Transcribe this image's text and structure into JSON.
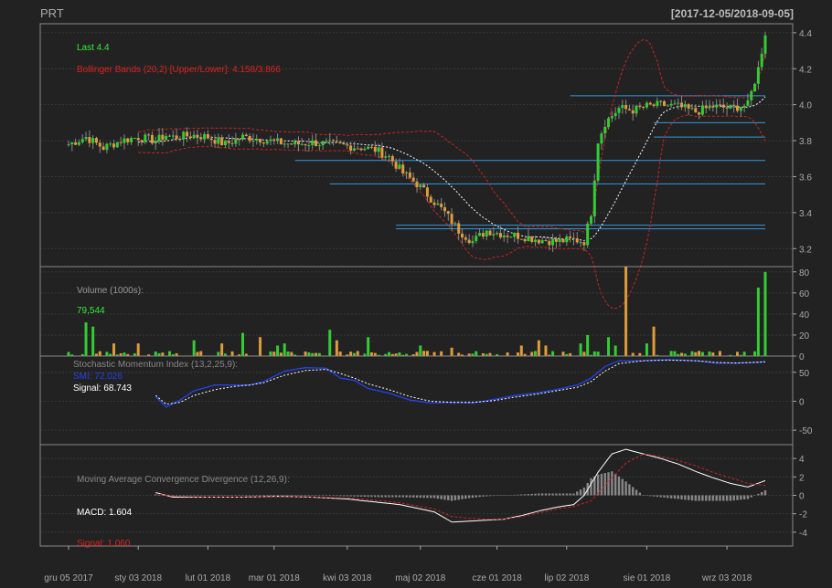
{
  "header": {
    "symbol": "PRT",
    "date_range": "[2017-12-05/2018-09-05]"
  },
  "colors": {
    "background": "#222222",
    "panel_border": "#888888",
    "grid": "#3a3a3a",
    "up": "#33cc33",
    "down": "#e09a3a",
    "bbands": "#cc2222",
    "sma": "#ffffff",
    "support_line": "#3399dd",
    "smi": "#2244ee",
    "signal": "#ffffff",
    "macd": "#ffffff",
    "macd_signal": "#cc2222",
    "histogram": "#888888",
    "axis_text": "#aaaaaa"
  },
  "chart_data": [
    {
      "type": "candlestick",
      "panel": "price",
      "title": "PRT",
      "date_range": "[2017-12-05/2018-09-05]",
      "last_label": "Last 4.4",
      "bbands_label": "Bollinger Bands (20,2) [Upper/Lower]: 4.158/3.866",
      "ylim": [
        3.1,
        4.45
      ],
      "y_ticks": [
        "3.2",
        "3.4",
        "3.6",
        "3.8",
        "4.0",
        "4.2",
        "4.4"
      ],
      "close_keypoints": [
        [
          0,
          3.78
        ],
        [
          5,
          3.82
        ],
        [
          10,
          3.76
        ],
        [
          15,
          3.8
        ],
        [
          20,
          3.82
        ],
        [
          25,
          3.8
        ],
        [
          28,
          3.83
        ],
        [
          30,
          3.82
        ],
        [
          36,
          3.83
        ],
        [
          40,
          3.82
        ],
        [
          45,
          3.78
        ],
        [
          50,
          3.82
        ],
        [
          55,
          3.81
        ],
        [
          60,
          3.79
        ],
        [
          65,
          3.78
        ],
        [
          70,
          3.79
        ],
        [
          75,
          3.78
        ],
        [
          80,
          3.77
        ],
        [
          85,
          3.76
        ],
        [
          88,
          3.75
        ],
        [
          92,
          3.71
        ],
        [
          96,
          3.62
        ],
        [
          100,
          3.56
        ],
        [
          104,
          3.48
        ],
        [
          108,
          3.4
        ],
        [
          112,
          3.3
        ],
        [
          116,
          3.24
        ],
        [
          120,
          3.3
        ],
        [
          125,
          3.28
        ],
        [
          130,
          3.27
        ],
        [
          135,
          3.25
        ],
        [
          140,
          3.24
        ],
        [
          145,
          3.25
        ],
        [
          148,
          3.24
        ],
        [
          150,
          3.4
        ],
        [
          152,
          3.8
        ],
        [
          154,
          3.9
        ],
        [
          158,
          3.98
        ],
        [
          162,
          3.97
        ],
        [
          166,
          3.99
        ],
        [
          170,
          4.0
        ],
        [
          175,
          3.99
        ],
        [
          180,
          3.96
        ],
        [
          185,
          3.99
        ],
        [
          190,
          3.98
        ],
        [
          195,
          4.0
        ],
        [
          198,
          4.2
        ],
        [
          200,
          4.4
        ]
      ],
      "support_lines": [
        {
          "y": 4.05,
          "from": 144
        },
        {
          "y": 3.9,
          "from": 168
        },
        {
          "y": 3.82,
          "from": 168
        },
        {
          "y": 3.69,
          "from": 65
        },
        {
          "y": 3.56,
          "from": 75
        },
        {
          "y": 3.33,
          "from": 94
        },
        {
          "y": 3.31,
          "from": 94
        },
        {
          "y": 3.1,
          "from": 111
        }
      ]
    },
    {
      "type": "bar",
      "panel": "volume",
      "label": "Volume (1000s):",
      "value_label": "79,544",
      "ylim": [
        0,
        85
      ],
      "y_ticks": [
        "0",
        "20",
        "40",
        "60",
        "80"
      ],
      "spikes": [
        [
          5,
          32
        ],
        [
          7,
          28
        ],
        [
          13,
          12
        ],
        [
          20,
          12
        ],
        [
          36,
          15
        ],
        [
          44,
          12
        ],
        [
          50,
          22
        ],
        [
          55,
          18
        ],
        [
          60,
          10
        ],
        [
          62,
          12
        ],
        [
          75,
          25
        ],
        [
          77,
          15
        ],
        [
          86,
          18
        ],
        [
          101,
          10
        ],
        [
          110,
          8
        ],
        [
          130,
          10
        ],
        [
          135,
          15
        ],
        [
          137,
          10
        ],
        [
          147,
          12
        ],
        [
          149,
          20
        ],
        [
          155,
          18
        ],
        [
          157,
          10
        ],
        [
          160,
          85
        ],
        [
          166,
          12
        ],
        [
          168,
          28
        ],
        [
          198,
          65
        ],
        [
          200,
          80
        ]
      ]
    },
    {
      "type": "line",
      "panel": "smi",
      "label": "Stochastic Momentum Index (13,2,25,9):",
      "smi_label": "SMI: 72.026",
      "signal_label": "Signal: 68.743",
      "ylim": [
        -75,
        78
      ],
      "y_ticks": [
        "-50",
        "0",
        "50"
      ],
      "smi_keypoints": [
        [
          25,
          8
        ],
        [
          28,
          -10
        ],
        [
          32,
          2
        ],
        [
          36,
          18
        ],
        [
          42,
          28
        ],
        [
          48,
          28
        ],
        [
          52,
          28
        ],
        [
          56,
          34
        ],
        [
          62,
          52
        ],
        [
          68,
          58
        ],
        [
          74,
          57
        ],
        [
          78,
          40
        ],
        [
          82,
          36
        ],
        [
          86,
          22
        ],
        [
          92,
          14
        ],
        [
          98,
          2
        ],
        [
          104,
          -3
        ],
        [
          110,
          -2
        ],
        [
          116,
          -3
        ],
        [
          122,
          3
        ],
        [
          128,
          10
        ],
        [
          134,
          14
        ],
        [
          140,
          20
        ],
        [
          146,
          28
        ],
        [
          150,
          40
        ],
        [
          154,
          60
        ],
        [
          158,
          70
        ],
        [
          165,
          70
        ],
        [
          172,
          72
        ],
        [
          180,
          70
        ],
        [
          186,
          66
        ],
        [
          192,
          66
        ],
        [
          200,
          68
        ]
      ],
      "signal_keypoints": [
        [
          25,
          10
        ],
        [
          28,
          -5
        ],
        [
          32,
          -2
        ],
        [
          36,
          10
        ],
        [
          42,
          20
        ],
        [
          48,
          26
        ],
        [
          52,
          28
        ],
        [
          56,
          32
        ],
        [
          62,
          45
        ],
        [
          68,
          53
        ],
        [
          74,
          55
        ],
        [
          78,
          48
        ],
        [
          82,
          40
        ],
        [
          86,
          30
        ],
        [
          92,
          20
        ],
        [
          98,
          8
        ],
        [
          104,
          0
        ],
        [
          110,
          -2
        ],
        [
          116,
          -2
        ],
        [
          122,
          1
        ],
        [
          128,
          7
        ],
        [
          134,
          12
        ],
        [
          140,
          18
        ],
        [
          146,
          24
        ],
        [
          150,
          34
        ],
        [
          154,
          52
        ],
        [
          158,
          65
        ],
        [
          165,
          70
        ],
        [
          172,
          71
        ],
        [
          180,
          70
        ],
        [
          186,
          67
        ],
        [
          192,
          66
        ],
        [
          200,
          68
        ]
      ]
    },
    {
      "type": "line",
      "panel": "macd",
      "label": "Moving Average Convergence Divergence (12,26,9):",
      "macd_label": "MACD: 1.604",
      "signal_label": "Signal: 1.060",
      "ylim": [
        -5.5,
        5.5
      ],
      "y_ticks": [
        "-4",
        "-2",
        "0",
        "2",
        "4"
      ],
      "macd_keypoints": [
        [
          25,
          0.3
        ],
        [
          30,
          -0.2
        ],
        [
          40,
          -0.2
        ],
        [
          50,
          -0.2
        ],
        [
          60,
          -0.1
        ],
        [
          70,
          -0.2
        ],
        [
          80,
          -0.4
        ],
        [
          90,
          -0.8
        ],
        [
          95,
          -1.0
        ],
        [
          105,
          -1.8
        ],
        [
          110,
          -2.9
        ],
        [
          115,
          -2.8
        ],
        [
          120,
          -2.7
        ],
        [
          125,
          -2.6
        ],
        [
          130,
          -2.2
        ],
        [
          135,
          -1.7
        ],
        [
          140,
          -1.3
        ],
        [
          145,
          -1.0
        ],
        [
          148,
          0.0
        ],
        [
          152,
          2.5
        ],
        [
          156,
          4.5
        ],
        [
          160,
          5.0
        ],
        [
          165,
          4.5
        ],
        [
          170,
          4.0
        ],
        [
          175,
          3.4
        ],
        [
          180,
          2.6
        ],
        [
          185,
          1.9
        ],
        [
          190,
          1.3
        ],
        [
          195,
          0.9
        ],
        [
          200,
          1.6
        ]
      ],
      "signal_keypoints": [
        [
          25,
          0.2
        ],
        [
          30,
          -0.1
        ],
        [
          40,
          -0.2
        ],
        [
          50,
          -0.2
        ],
        [
          60,
          -0.1
        ],
        [
          70,
          -0.2
        ],
        [
          80,
          -0.3
        ],
        [
          90,
          -0.6
        ],
        [
          95,
          -0.8
        ],
        [
          105,
          -1.5
        ],
        [
          110,
          -2.3
        ],
        [
          115,
          -2.5
        ],
        [
          120,
          -2.6
        ],
        [
          125,
          -2.6
        ],
        [
          130,
          -2.3
        ],
        [
          135,
          -1.9
        ],
        [
          140,
          -1.5
        ],
        [
          145,
          -1.2
        ],
        [
          150,
          -0.6
        ],
        [
          155,
          1.5
        ],
        [
          160,
          3.5
        ],
        [
          165,
          4.5
        ],
        [
          170,
          4.2
        ],
        [
          175,
          3.8
        ],
        [
          180,
          3.2
        ],
        [
          185,
          2.5
        ],
        [
          190,
          1.9
        ],
        [
          195,
          1.3
        ],
        [
          200,
          1.06
        ]
      ]
    }
  ],
  "x_axis": {
    "labels": [
      "gru 05 2017",
      "sty 03 2018",
      "lut 01 2018",
      "mar 01 2018",
      "kwi 03 2018",
      "maj 02 2018",
      "cze 01 2018",
      "lip 02 2018",
      "sie 01 2018",
      "wrz 03 2018"
    ],
    "label_index": [
      0,
      20,
      40,
      59,
      80,
      101,
      123,
      143,
      166,
      189
    ],
    "count": 201
  }
}
